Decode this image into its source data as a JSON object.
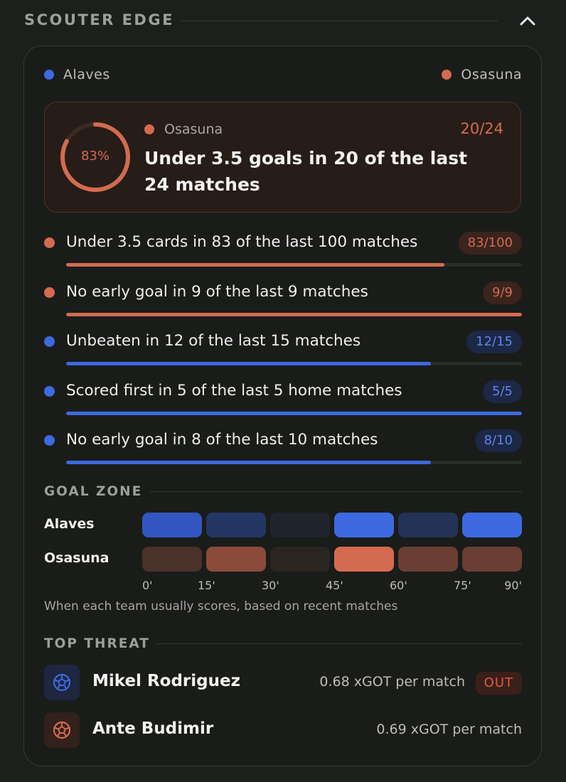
{
  "header": {
    "title": "SCOUTER EDGE",
    "collapse_icon": "chevron-up-icon"
  },
  "teams": {
    "home": {
      "name": "Alaves",
      "color": "#3d6ae0"
    },
    "away": {
      "name": "Osasuna",
      "color": "#d46b50"
    }
  },
  "featured": {
    "percent_label": "83%",
    "percent": 0.83,
    "team": "Osasuna",
    "count": "20/24",
    "text": "Under 3.5 goals in 20 of the last 24 matches"
  },
  "stats": [
    {
      "team": "away",
      "text": "Under 3.5 cards in 83 of the last 100 matches",
      "badge": "83/100",
      "fraction": 0.83
    },
    {
      "team": "away",
      "text": "No early goal in 9 of the last 9 matches",
      "badge": "9/9",
      "fraction": 1.0
    },
    {
      "team": "home",
      "text": "Unbeaten in 12 of the last 15 matches",
      "badge": "12/15",
      "fraction": 0.8
    },
    {
      "team": "home",
      "text": "Scored first in 5 of the last 5 home matches",
      "badge": "5/5",
      "fraction": 1.0
    },
    {
      "team": "home",
      "text": "No early goal in 8 of the last 10 matches",
      "badge": "8/10",
      "fraction": 0.8
    }
  ],
  "goal_zone": {
    "title": "GOAL ZONE",
    "rows": [
      {
        "team": "Alaves",
        "cells": [
          "#3356c0",
          "#243764",
          "#20242c",
          "#3d6ae0",
          "#243257",
          "#3d6ae0"
        ]
      },
      {
        "team": "Osasuna",
        "cells": [
          "#4a312a",
          "#8c4b3a",
          "#2b2522",
          "#d46b50",
          "#6a3e33",
          "#6a3e33"
        ]
      }
    ],
    "ticks": [
      "0'",
      "15'",
      "30'",
      "45'",
      "60'",
      "75'",
      "90'"
    ],
    "note": "When each team usually scores, based on recent matches"
  },
  "top_threat": {
    "title": "TOP THREAT",
    "players": [
      {
        "name": "Mikel Rodriguez",
        "team": "home",
        "icon": "soccer-ball-icon",
        "xgot": "0.68 xGOT per match",
        "status": "OUT"
      },
      {
        "name": "Ante Budimir",
        "team": "away",
        "icon": "soccer-ball-icon",
        "xgot": "0.69 xGOT per match",
        "status": ""
      }
    ]
  }
}
